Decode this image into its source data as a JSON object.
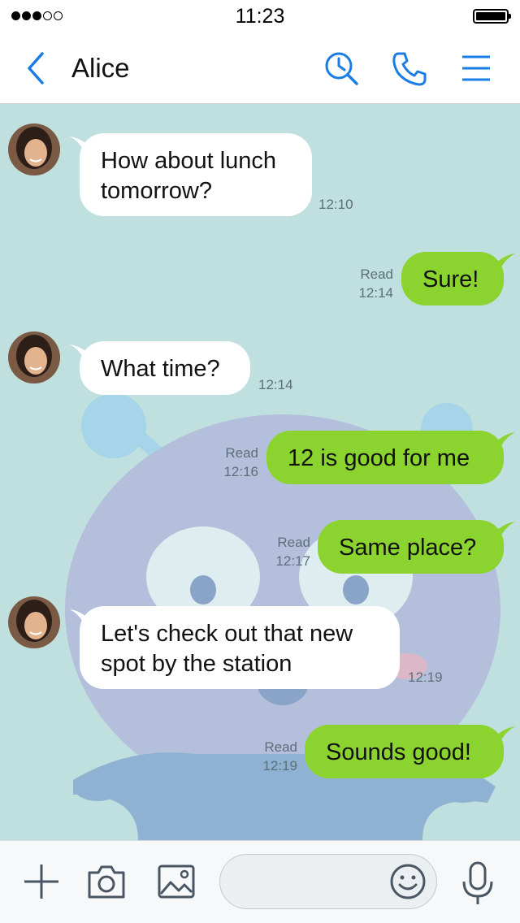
{
  "status": {
    "time": "11:23"
  },
  "header": {
    "title": "Alice"
  },
  "messages": [
    {
      "side": "in",
      "text": "How about lunch tomorrow?",
      "line1": "How about lunch",
      "line2": "tomorrow?",
      "time": "12:10"
    },
    {
      "side": "out",
      "text": "Sure!",
      "read": "Read",
      "time": "12:14"
    },
    {
      "side": "in",
      "text": "What time?",
      "time": "12:14"
    },
    {
      "side": "out",
      "text": "12 is good for me",
      "read": "Read",
      "time": "12:16"
    },
    {
      "side": "out",
      "text": "Same place?",
      "read": "Read",
      "time": "12:17"
    },
    {
      "side": "in",
      "text": "Let's check out that new spot by the station",
      "line1": "Let's check out that new",
      "line2": "spot by the station",
      "time": "12:19"
    },
    {
      "side": "out",
      "text": "Sounds good!",
      "read": "Read",
      "time": "12:19"
    }
  ],
  "input": {
    "value": "",
    "placeholder": ""
  },
  "icons": {
    "back": "chevron-left-icon",
    "search": "clock-search-icon",
    "call": "phone-icon",
    "menu": "hamburger-menu-icon",
    "add": "plus-icon",
    "camera": "camera-icon",
    "image": "image-icon",
    "emoji": "smiley-icon",
    "mic": "microphone-icon"
  },
  "colors": {
    "accent": "#1a7de6",
    "outgoing": "#8bd32e",
    "incoming": "#ffffff",
    "chat_bg": "#bfe0de"
  }
}
